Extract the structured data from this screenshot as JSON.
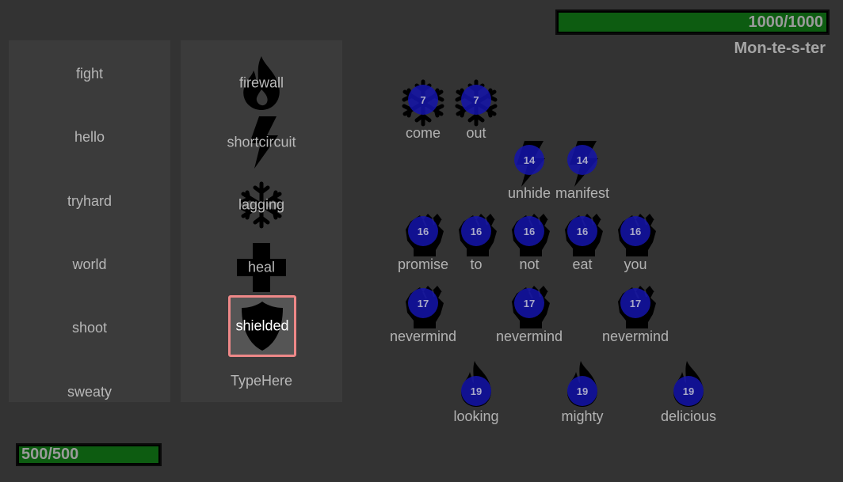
{
  "words": [
    "fight",
    "hello",
    "tryhard",
    "world",
    "shoot",
    "sweaty"
  ],
  "spells": [
    {
      "label": "firewall",
      "icon": "flame-icon"
    },
    {
      "label": "shortcircuit",
      "icon": "lightning-icon"
    },
    {
      "label": "lagging",
      "icon": "snowflake-icon"
    },
    {
      "label": "heal",
      "icon": "cross-icon"
    },
    {
      "label": "shielded",
      "icon": "shield-icon",
      "selected": true
    }
  ],
  "type_here": "TypeHere",
  "enemy": {
    "hp_text": "1000/1000",
    "hp_fraction": 1.0,
    "name": "Mon-te-s-ter"
  },
  "player": {
    "hp_text": "500/500",
    "hp_fraction": 1.0
  },
  "enemy_words": [
    {
      "word": "come",
      "timer": "7",
      "icon": "snowflake-icon"
    },
    {
      "word": "out",
      "timer": "7",
      "icon": "snowflake-icon"
    },
    {
      "word": "unhide",
      "timer": "14",
      "icon": "lightning-icon"
    },
    {
      "word": "manifest",
      "timer": "14",
      "icon": "lightning-icon"
    },
    {
      "word": "promise",
      "timer": "16",
      "icon": "fist-icon"
    },
    {
      "word": "to",
      "timer": "16",
      "icon": "fist-icon"
    },
    {
      "word": "not",
      "timer": "16",
      "icon": "fist-icon"
    },
    {
      "word": "eat",
      "timer": "16",
      "icon": "fist-icon"
    },
    {
      "word": "you",
      "timer": "16",
      "icon": "fist-icon"
    },
    {
      "word": "nevermind",
      "timer": "17",
      "icon": "fist-icon"
    },
    {
      "word": "nevermind",
      "timer": "17",
      "icon": "fist-icon"
    },
    {
      "word": "nevermind",
      "timer": "17",
      "icon": "fist-icon"
    },
    {
      "word": "looking",
      "timer": "19",
      "icon": "flame-icon"
    },
    {
      "word": "mighty",
      "timer": "19",
      "icon": "flame-icon"
    },
    {
      "word": "delicious",
      "timer": "19",
      "icon": "flame-icon"
    }
  ],
  "colors": {
    "background": "#333333",
    "panel": "#3b3b3b",
    "hp_fill": "#0d5c11",
    "timer_circle": "#1414aa",
    "selected_border": "#ee8888"
  }
}
